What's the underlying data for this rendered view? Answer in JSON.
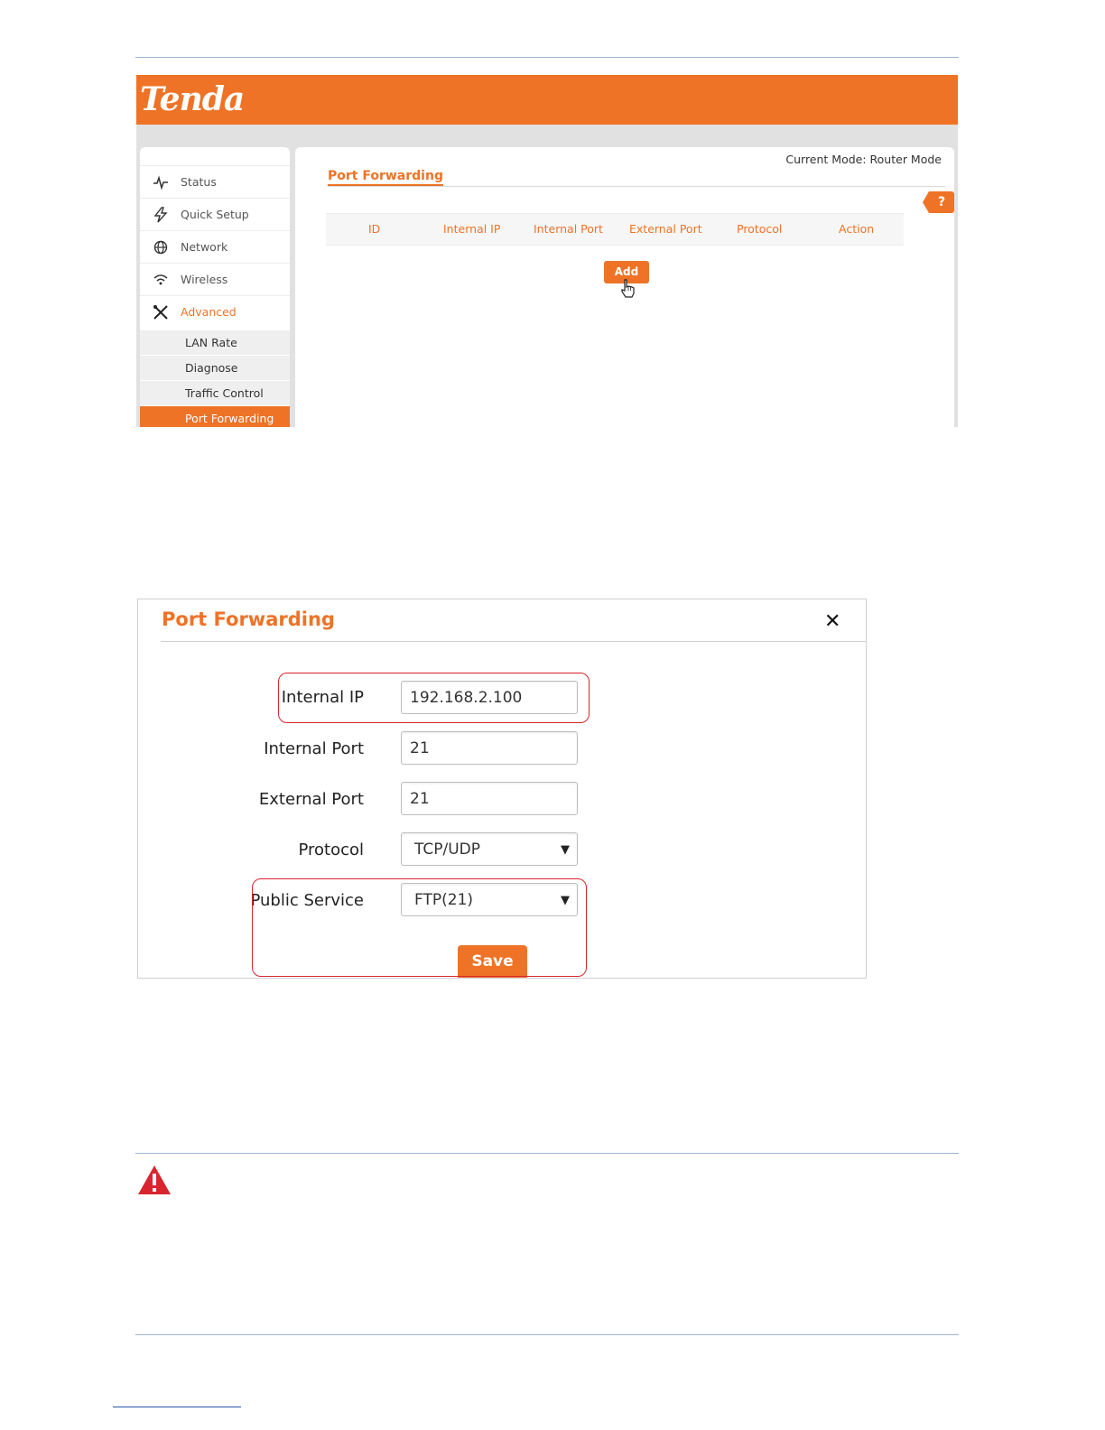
{
  "brand": {
    "logo_text": "Tenda",
    "accent": "#ee7326"
  },
  "sidebar": {
    "items": [
      {
        "label": "Status",
        "icon": "pulse-icon"
      },
      {
        "label": "Quick Setup",
        "icon": "bolt-icon"
      },
      {
        "label": "Network",
        "icon": "globe-icon"
      },
      {
        "label": "Wireless",
        "icon": "wifi-icon"
      },
      {
        "label": "Advanced",
        "icon": "tools-icon"
      }
    ],
    "subitems": [
      "LAN Rate",
      "Diagnose",
      "Traffic Control",
      "Port Forwarding"
    ]
  },
  "main": {
    "mode": "Current Mode: Router Mode",
    "title": "Port Forwarding",
    "help": "?",
    "columns": [
      "ID",
      "Internal IP",
      "Internal Port",
      "External Port",
      "Protocol",
      "Action"
    ],
    "add_label": "Add"
  },
  "dialog": {
    "title": "Port Forwarding",
    "close": "✕",
    "internal_ip_label": "Internal IP",
    "internal_ip_value": "192.168.2.100",
    "internal_port_label": "Internal Port",
    "internal_port_value": "21",
    "external_port_label": "External Port",
    "external_port_value": "21",
    "protocol_label": "Protocol",
    "protocol_value": "TCP/UDP",
    "public_service_label": "Public Service",
    "public_service_value": "FTP(21)",
    "save_label": "Save",
    "highlight_color": "#d9252f"
  },
  "warning": {
    "icon": "warning-triangle-icon",
    "color": "#d9252f"
  }
}
